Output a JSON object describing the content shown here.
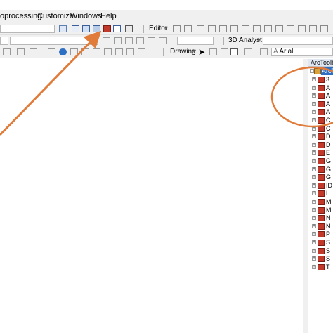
{
  "menu": [
    "oprocessing",
    "Customize",
    "Windows",
    "Help"
  ],
  "toolbar1": {
    "editor_label": "Editor"
  },
  "toolbar2": {
    "analyst_label": "3D Analyst"
  },
  "toolbar3": {
    "drawing_label": "Drawing",
    "font_value": "Arial"
  },
  "arctoolbox": {
    "title": "ArcToolbo",
    "root": "ArcT",
    "items": [
      "3",
      "A",
      "A",
      "A",
      "A",
      "C",
      "C",
      "D",
      "D",
      "E",
      "G",
      "G",
      "G",
      "ID",
      "L",
      "M",
      "M",
      "N",
      "N",
      "P",
      "S",
      "S",
      "S",
      "T"
    ]
  },
  "annotation_color": "#e07b39"
}
